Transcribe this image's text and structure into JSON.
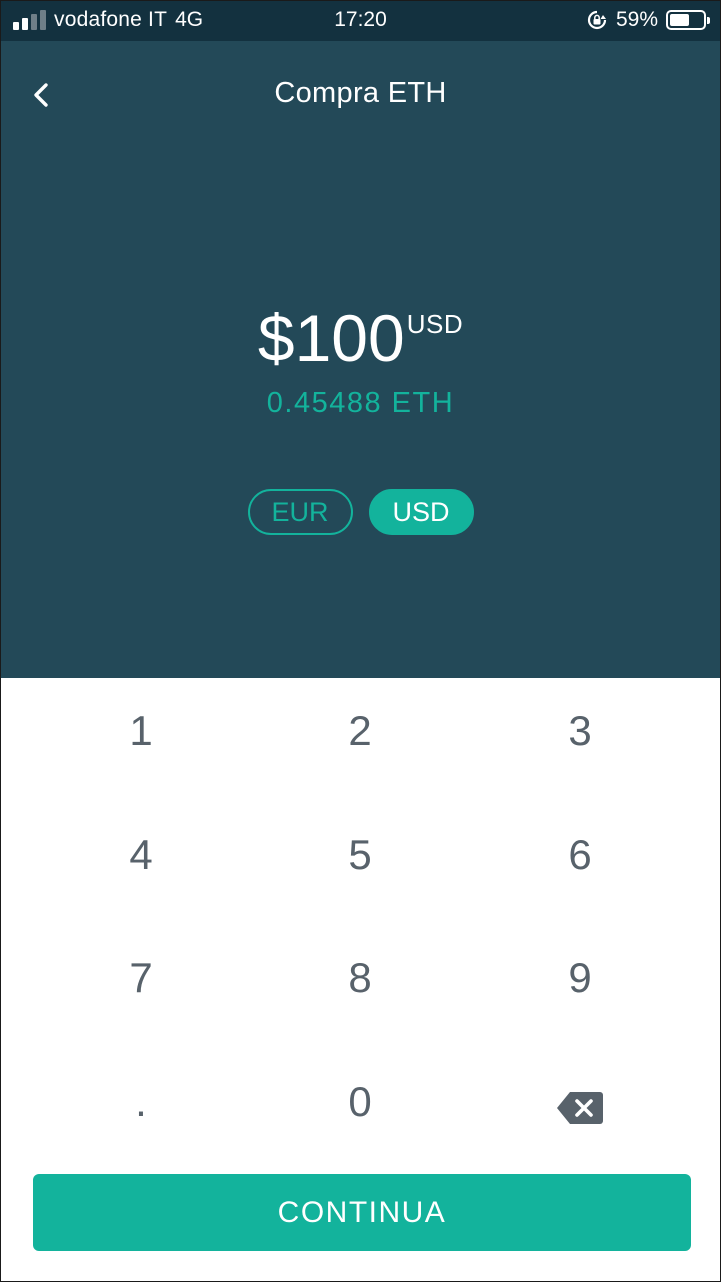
{
  "status_bar": {
    "carrier": "vodafone IT",
    "network": "4G",
    "time": "17:20",
    "battery_percent": "59%",
    "battery_level": 0.59
  },
  "header": {
    "title": "Compra ETH",
    "back_icon": "chevron-left-icon"
  },
  "amount": {
    "value": "$100",
    "unit": "USD",
    "converted": "0.45488 ETH"
  },
  "currency_toggle": {
    "options": [
      "EUR",
      "USD"
    ],
    "selected": "USD"
  },
  "keypad": {
    "keys": [
      "1",
      "2",
      "3",
      "4",
      "5",
      "6",
      "7",
      "8",
      "9",
      ".",
      "0"
    ],
    "backspace_icon": "backspace-icon"
  },
  "continue_button": {
    "label": "CONTINUA"
  },
  "colors": {
    "status_bar_bg": "#13313f",
    "panel_bg": "#234958",
    "accent": "#13b39c",
    "key_text": "#58626b"
  }
}
